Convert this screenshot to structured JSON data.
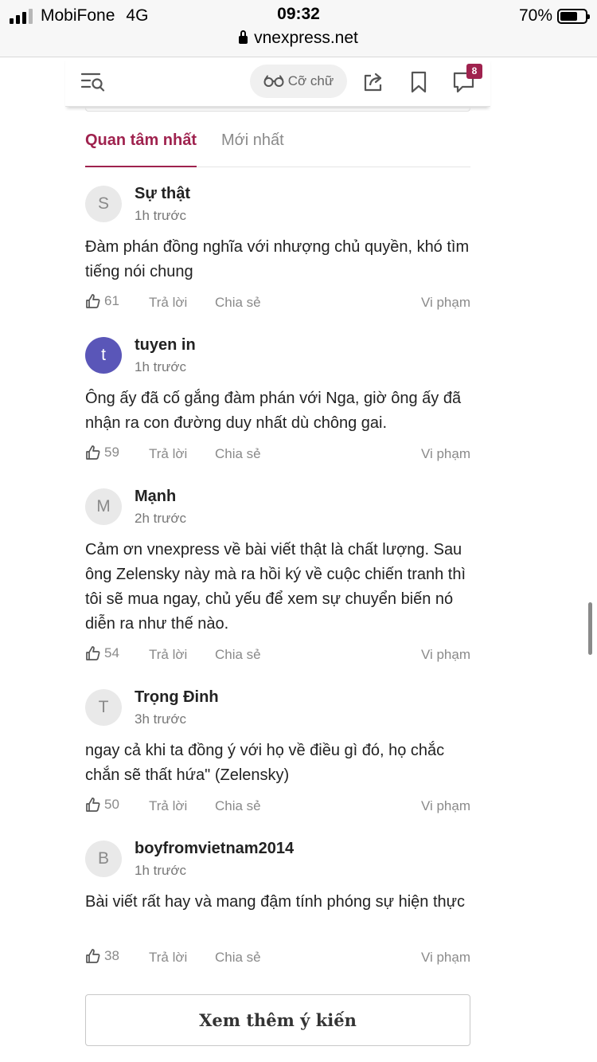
{
  "status_bar": {
    "carrier": "MobiFone",
    "network": "4G",
    "time": "09:32",
    "url": "vnexpress.net",
    "battery": "70%",
    "battery_level": 0.7
  },
  "toolbar": {
    "font_size_label": "Cỡ chữ",
    "comment_count": "8"
  },
  "tabs": {
    "hot": "Quan tâm nhất",
    "new": "Mới nhất"
  },
  "comments": [
    {
      "initial": "S",
      "name": "Sự thật",
      "time": "1h trước",
      "text": "Đàm phán đồng nghĩa với nhượng chủ quyền, khó tìm tiếng nói chung",
      "likes": "61",
      "reply": "Trả lời",
      "share": "Chia sẻ",
      "report": "Vi phạm"
    },
    {
      "initial": "t",
      "name": "tuyen in",
      "time": "1h trước",
      "text": "Ông ấy đã cố gắng đàm phán với Nga, giờ ông ấy đã nhận ra con đường duy nhất dù chông gai.",
      "likes": "59",
      "reply": "Trả lời",
      "share": "Chia sẻ",
      "report": "Vi phạm"
    },
    {
      "initial": "M",
      "name": "Mạnh",
      "time": "2h trước",
      "text": "Cảm ơn vnexpress về bài viết thật là chất lượng. Sau ông Zelensky này mà ra hồi ký về cuộc chiến tranh thì tôi sẽ mua ngay, chủ yếu để xem sự chuyển biến nó diễn ra như thế nào.",
      "likes": "54",
      "reply": "Trả lời",
      "share": "Chia sẻ",
      "report": "Vi phạm"
    },
    {
      "initial": "T",
      "name": "Trọng Đinh",
      "time": "3h trước",
      "text": "ngay cả khi ta đồng ý với họ về điều gì đó, họ chắc chắn sẽ thất hứa\" (Zelensky)",
      "likes": "50",
      "reply": "Trả lời",
      "share": "Chia sẻ",
      "report": "Vi phạm"
    },
    {
      "initial": "B",
      "name": "boyfromvietnam2014",
      "time": "1h trước",
      "text": "Bài viết rất hay và mang đậm tính phóng sự hiện thực",
      "likes": "38",
      "reply": "Trả lời",
      "share": "Chia sẻ",
      "report": "Vi phạm"
    }
  ],
  "more_button": "Xem thêm ý kiến",
  "colors": {
    "accent": "#9f224e",
    "avatar_purple": "#5a56b8",
    "muted": "#8a8a8a"
  }
}
